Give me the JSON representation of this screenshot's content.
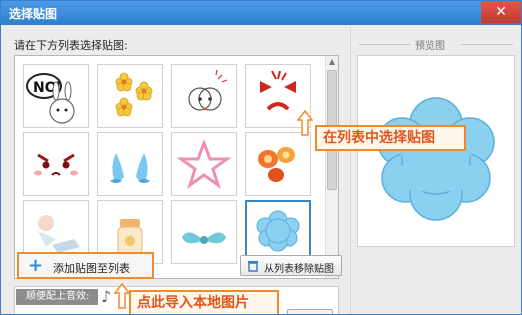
{
  "window": {
    "title": "选择贴图",
    "close_glyph": "✕"
  },
  "list": {
    "prompt": "请在下方列表选择贴图:",
    "items": [
      {
        "name": "no-rabbit-sticker"
      },
      {
        "name": "yellow-flowers-sticker"
      },
      {
        "name": "face-sticker"
      },
      {
        "name": "angry-face-sticker"
      },
      {
        "name": "angry-eyes-sticker"
      },
      {
        "name": "tears-sticker"
      },
      {
        "name": "pink-star-sticker"
      },
      {
        "name": "lanterns-sticker"
      },
      {
        "name": "girl-sticker"
      },
      {
        "name": "jar-sticker"
      },
      {
        "name": "bow-sticker"
      },
      {
        "name": "blue-cloud-sticker"
      }
    ],
    "selected_index": 11
  },
  "buttons": {
    "add": "添加贴图至列表",
    "remove": "从列表移除贴图"
  },
  "sound": {
    "label": "顺便配上音效:"
  },
  "preview": {
    "title": "预览图"
  },
  "callouts": {
    "select": "在列表中选择贴图",
    "import": "点此导入本地图片"
  },
  "colors": {
    "accent_orange": "#ee8c2b",
    "callout_text": "#e0561b",
    "titlebar_blue": "#2f7fd0",
    "cloud_blue": "#8cd0f0"
  }
}
